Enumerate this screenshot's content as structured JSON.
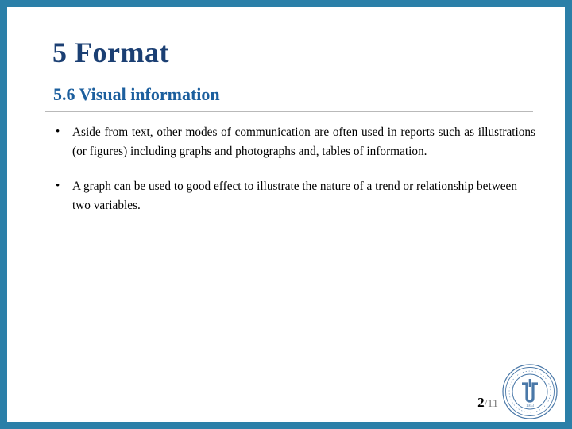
{
  "slide": {
    "title": "5 Format",
    "subtitle": "5.6 Visual information",
    "bullets": [
      {
        "marker": "•",
        "text": "Aside from text, other modes of communication are often used in reports such as illustrations (or figures) including graphs and photographs and, tables of information."
      },
      {
        "marker": "•",
        "text": "A graph can be used to good effect to illustrate the nature of a trend or relationship between two variables."
      }
    ],
    "footer": {
      "current_page": "2",
      "separator": "/",
      "total_pages": "11"
    },
    "logo": {
      "name": "university-seal-logo",
      "outer_text": "UNIVERSITY SEAL",
      "year": "1953"
    },
    "colors": {
      "border": "#2b7fa8",
      "title": "#1b3f73",
      "subtitle": "#1c5f9e",
      "rule": "#b9b9b9",
      "logo": "#4a78a8"
    }
  }
}
